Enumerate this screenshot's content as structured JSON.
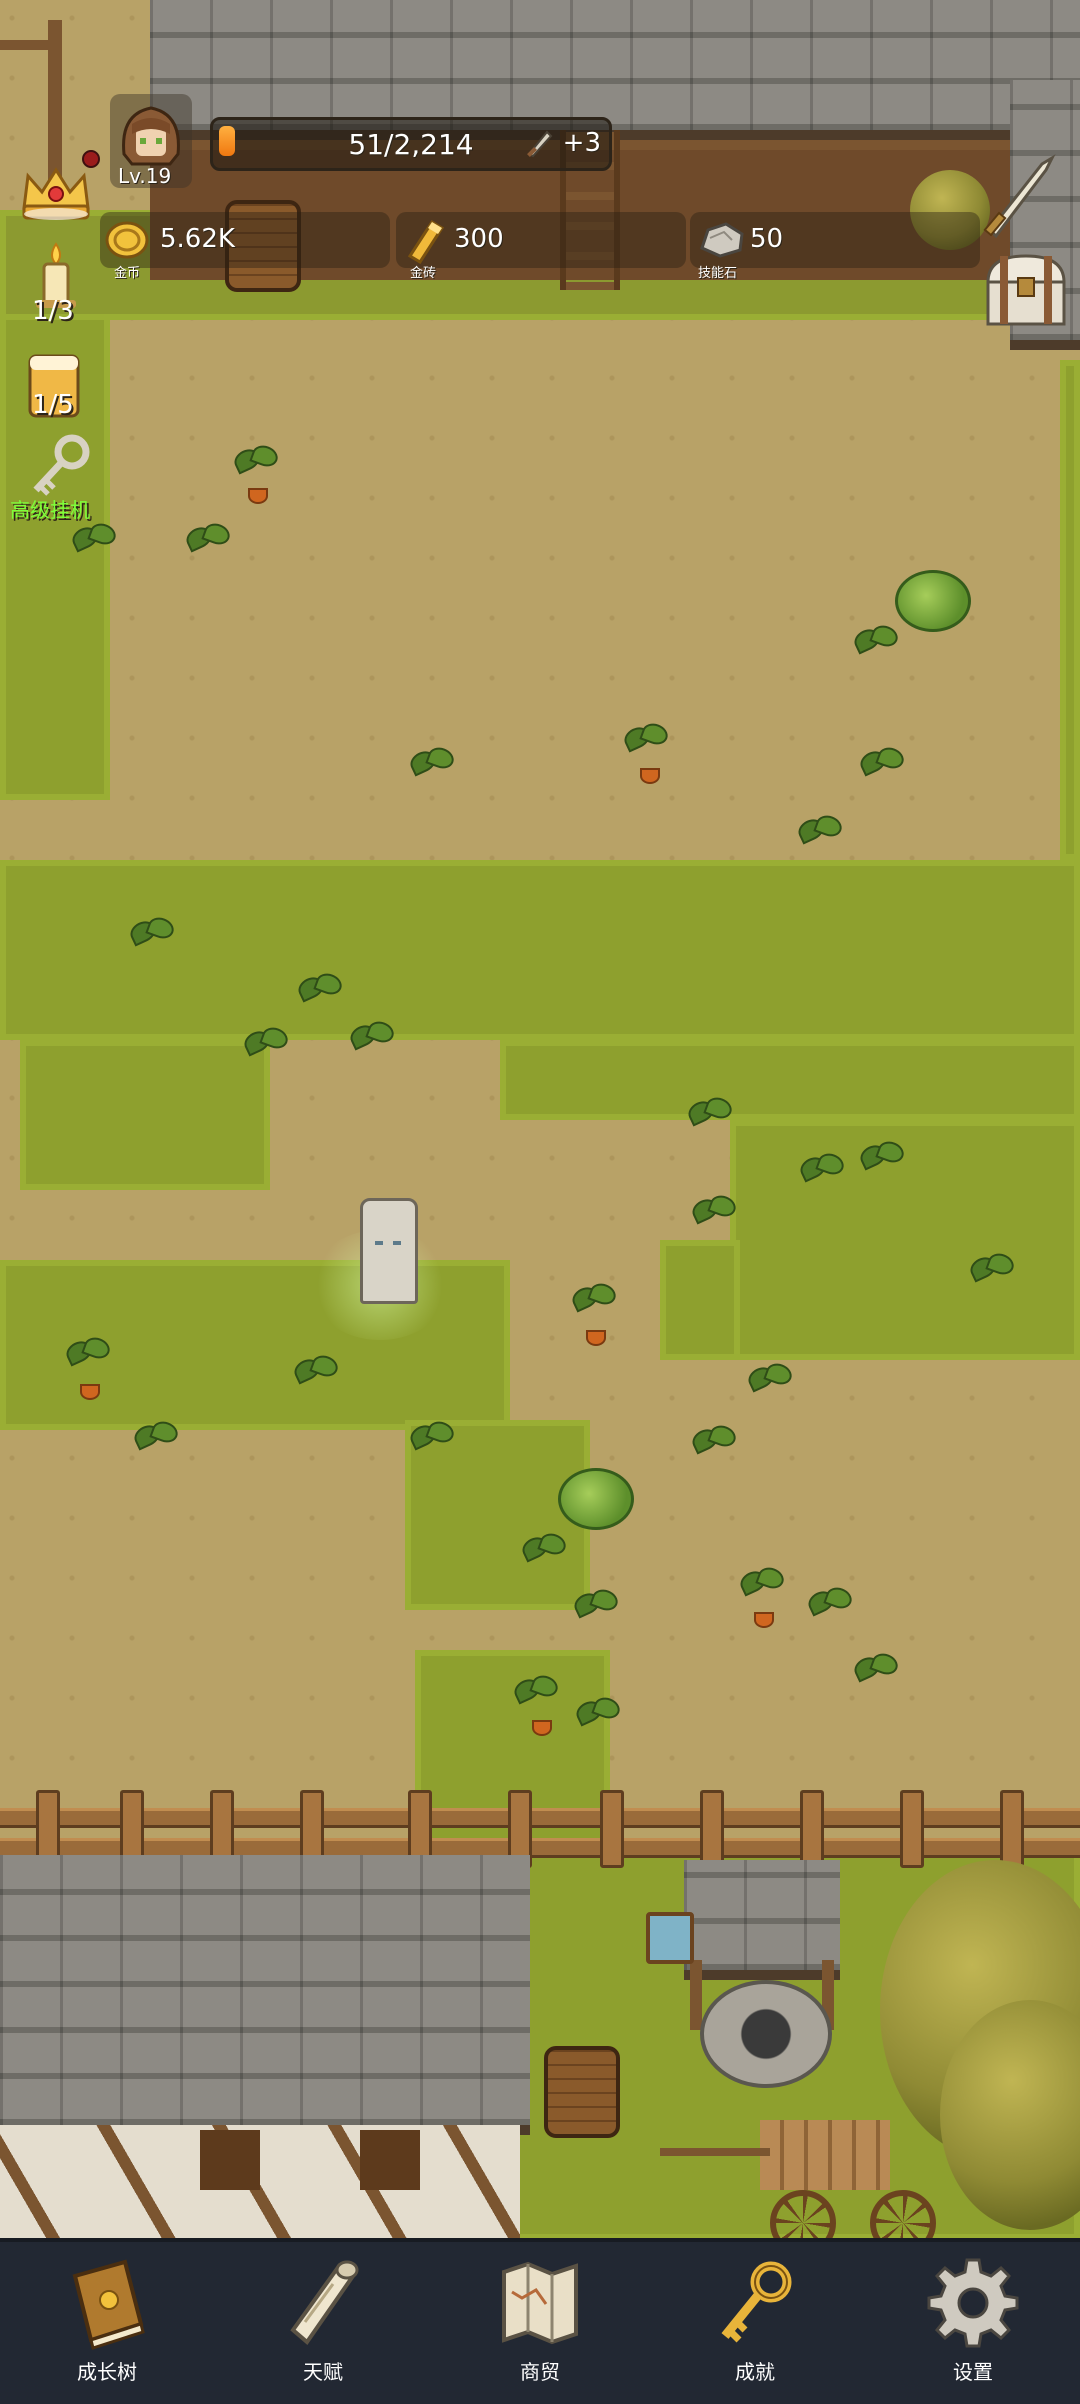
{
  "player": {
    "level": "Lv.19",
    "xp_text": "51/2,214",
    "xp_fraction": 0.023,
    "xp_bonus": "+3"
  },
  "resources": {
    "gold": {
      "value": "5.62K",
      "caption": "金币",
      "icon": "gold-coin-icon"
    },
    "gold_brick": {
      "value": "300",
      "caption": "金砖",
      "icon": "gold-brick-icon"
    },
    "skill_stone": {
      "value": "50",
      "caption": "技能石",
      "icon": "skill-stone-icon"
    }
  },
  "side_buttons": {
    "candle_count": "1/3",
    "drink_count": "1/5",
    "auto_idle_label": "高级挂机"
  },
  "nav": {
    "items": [
      {
        "label": "成长树",
        "icon": "book-icon"
      },
      {
        "label": "天赋",
        "icon": "scroll-icon"
      },
      {
        "label": "商贸",
        "icon": "map-icon"
      },
      {
        "label": "成就",
        "icon": "key-icon"
      },
      {
        "label": "设置",
        "icon": "gear-icon"
      }
    ]
  },
  "colors": {
    "ground": "#b8a267",
    "grass": "#8ea02e",
    "nav_bg": "#222833",
    "xp_fill": "#f07810",
    "idle_label": "#7dff3a"
  }
}
